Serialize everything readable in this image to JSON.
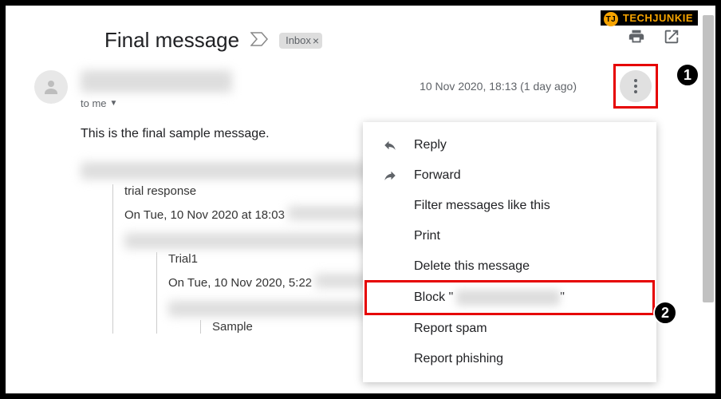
{
  "watermark": "TECHJUNKIE",
  "subject": "Final message",
  "inbox_label": "Inbox",
  "to_line": "to me",
  "timestamp": "10 Nov 2020, 18:13 (1 day ago)",
  "body": "This is the final sample message.",
  "quoted": {
    "line1": "trial response",
    "line2_prefix": "On Tue, 10 Nov 2020 at 18:03",
    "line3": "Trial1",
    "line4_prefix": "On Tue, 10 Nov 2020, 5:22",
    "line5": "Sample"
  },
  "menu": {
    "reply": "Reply",
    "forward": "Forward",
    "filter": "Filter messages like this",
    "print": "Print",
    "delete": "Delete this message",
    "block_prefix": "Block \"",
    "block_suffix": "\"",
    "report_spam": "Report spam",
    "report_phishing": "Report phishing"
  },
  "badges": {
    "one": "1",
    "two": "2"
  }
}
